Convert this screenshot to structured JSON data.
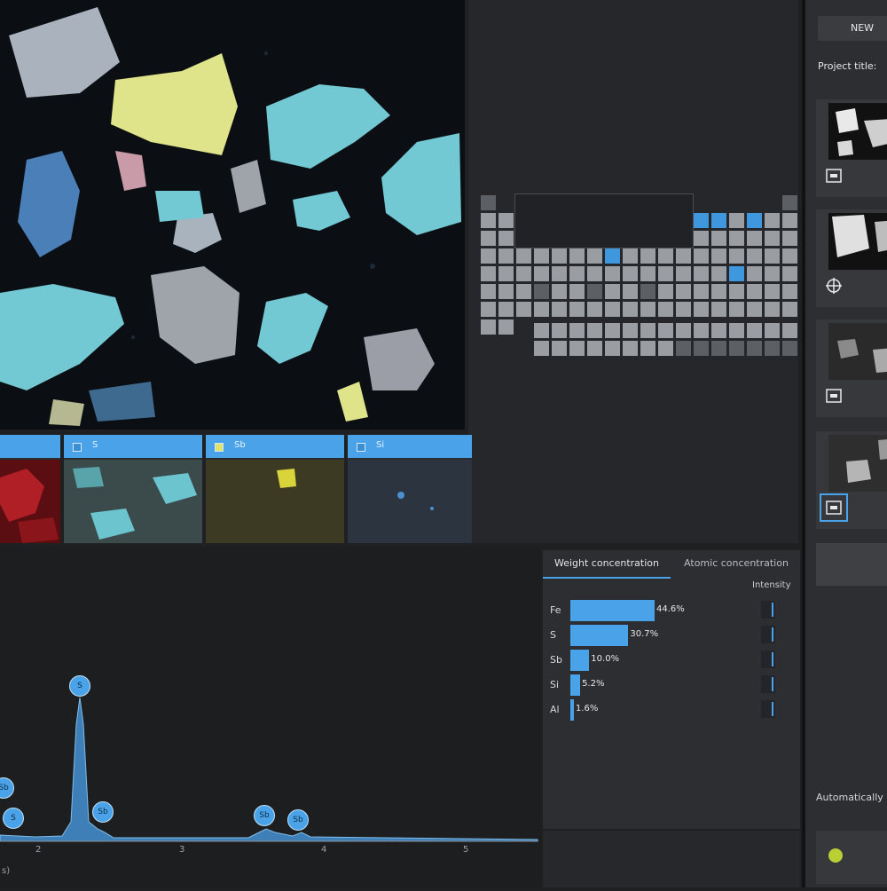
{
  "channels": [
    {
      "label": ""
    },
    {
      "label": "S"
    },
    {
      "label": "Sb"
    },
    {
      "label": "Si"
    }
  ],
  "spectrum": {
    "peaks": [
      "S",
      "Sb",
      "Sb",
      "S",
      "Sb",
      "Sb",
      "Sb"
    ],
    "axis_ticks": [
      "2",
      "3",
      "4",
      "5"
    ],
    "axis_unit": "s)"
  },
  "concentration": {
    "tabs": [
      "Weight concentration",
      "Atomic concentration"
    ],
    "intensity_label": "Intensity",
    "rows": [
      {
        "symbol": "Fe",
        "value_label": "44.6%",
        "value": 44.6
      },
      {
        "symbol": "S",
        "value_label": "30.7%",
        "value": 30.7
      },
      {
        "symbol": "Sb",
        "value_label": "10.0%",
        "value": 10.0
      },
      {
        "symbol": "Si",
        "value_label": "5.2%",
        "value": 5.2
      },
      {
        "symbol": "Al",
        "value_label": "1.6%",
        "value": 1.6
      }
    ]
  },
  "sidebar": {
    "new_label": "NEW",
    "project_title_label": "Project title:",
    "auto_label": "Automatically i"
  },
  "colors": {
    "accent": "#4aa3e8",
    "panel": "#25272a",
    "background": "#1f2022",
    "indicator": "#b9cf34"
  }
}
